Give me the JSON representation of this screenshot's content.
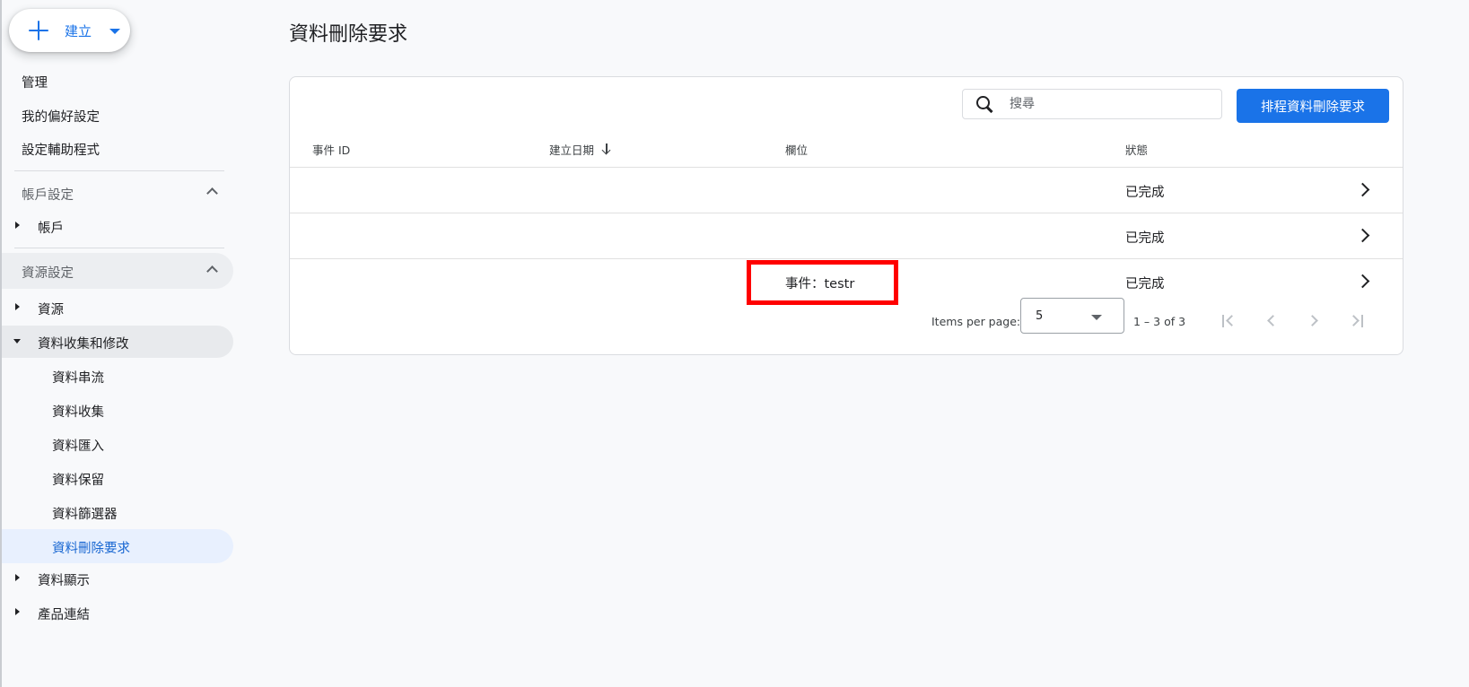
{
  "create": {
    "label": "建立"
  },
  "sidebar": {
    "top_links": [
      "管理",
      "我的偏好設定",
      "設定輔助程式"
    ],
    "account_section": {
      "title": "帳戶設定",
      "items": [
        "帳戶"
      ]
    },
    "property_section": {
      "title": "資源設定",
      "items": [
        {
          "label": "資源",
          "expanded": false
        },
        {
          "label": "資料收集和修改",
          "expanded": true,
          "children": [
            "資料串流",
            "資料收集",
            "資料匯入",
            "資料保留",
            "資料篩選器",
            "資料刪除要求"
          ]
        },
        {
          "label": "資料顯示",
          "expanded": false
        },
        {
          "label": "產品連結",
          "expanded": false
        }
      ],
      "active_child": "資料刪除要求"
    }
  },
  "main": {
    "title": "資料刪除要求",
    "search": {
      "placeholder": "搜尋",
      "value": ""
    },
    "schedule_button": "排程資料刪除要求",
    "columns": {
      "event_id": "事件 ID",
      "created": "建立日期",
      "field": "欄位",
      "status": "狀態"
    },
    "rows": [
      {
        "event_id": "",
        "created": "",
        "field": "",
        "status": "已完成"
      },
      {
        "event_id": "",
        "created": "",
        "field": "",
        "status": "已完成"
      },
      {
        "event_id": "",
        "created": "",
        "field": "事件：testr",
        "status": "已完成"
      }
    ],
    "paginator": {
      "items_per_page_label": "Items per page:",
      "page_size": "5",
      "range": "1 – 3 of 3"
    }
  },
  "colors": {
    "accent": "#1a73e8",
    "active_bg": "#e8f0fe",
    "highlight": "#ff0000"
  }
}
